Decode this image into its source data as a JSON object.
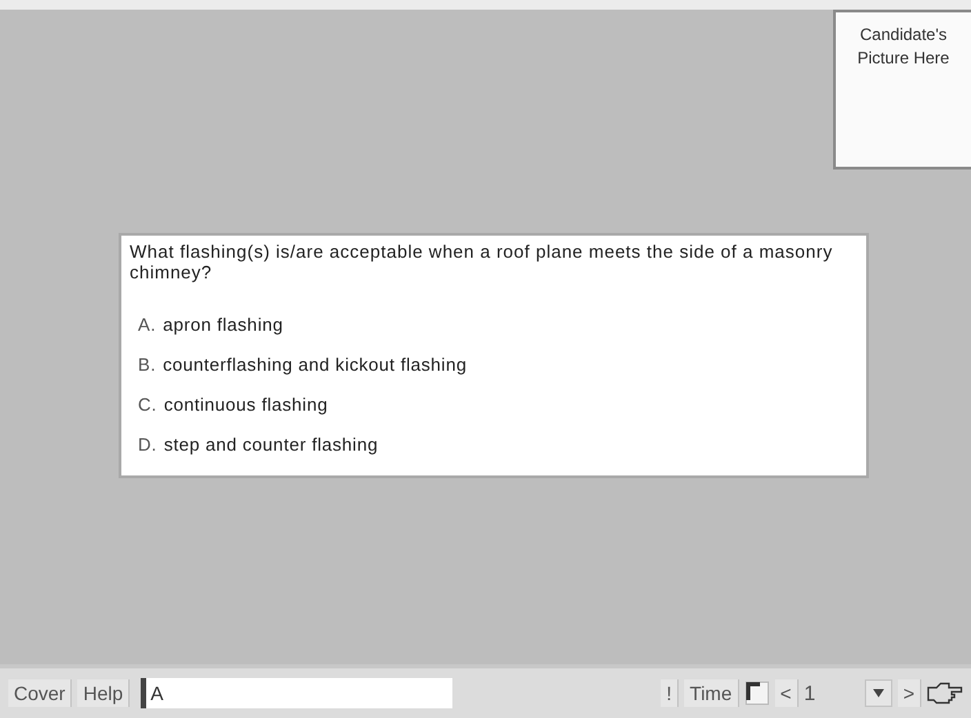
{
  "candidate_picture": {
    "text": "Candidate's Picture Here"
  },
  "question": {
    "text": "What flashing(s) is/are acceptable when a roof plane meets the side of a masonry chimney?",
    "options": [
      {
        "letter": "A.",
        "text": "apron flashing"
      },
      {
        "letter": "B.",
        "text": "counterflashing and kickout flashing"
      },
      {
        "letter": "C.",
        "text": "continuous flashing"
      },
      {
        "letter": "D.",
        "text": "step and counter flashing"
      }
    ]
  },
  "toolbar": {
    "cover": "Cover",
    "help": "Help",
    "answer": {
      "value": "A"
    },
    "flag": "!",
    "time": "Time",
    "previous": "<",
    "question_number": "1",
    "next": ">"
  }
}
